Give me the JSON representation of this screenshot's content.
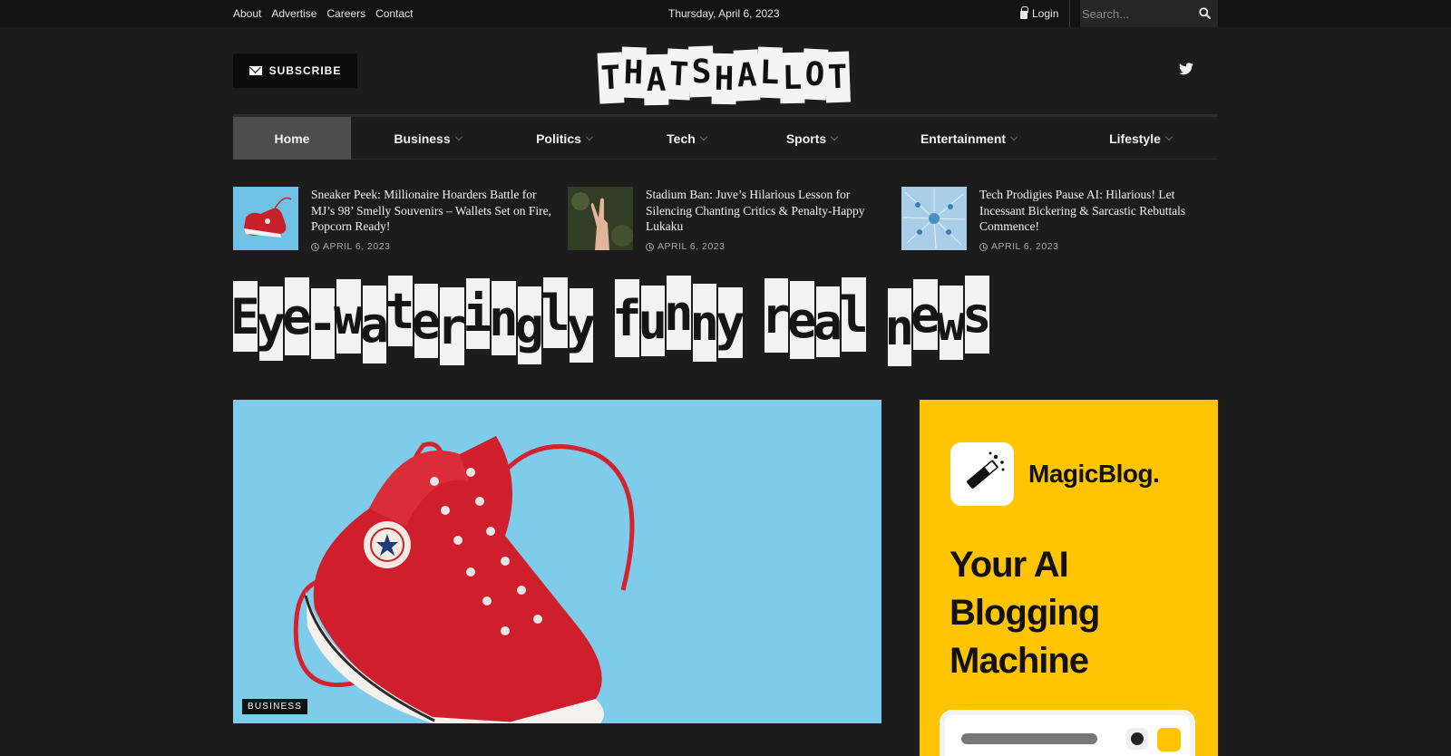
{
  "topbar": {
    "links": [
      "About",
      "Advertise",
      "Careers",
      "Contact"
    ],
    "date": "Thursday, April 6, 2023",
    "login": "Login",
    "search_placeholder": "Search..."
  },
  "header": {
    "subscribe_label": "SUBSCRIBE",
    "logo_text": "THATSHALLOT"
  },
  "nav": {
    "items": [
      {
        "label": "Home",
        "active": true
      },
      {
        "label": "Business"
      },
      {
        "label": "Politics"
      },
      {
        "label": "Tech"
      },
      {
        "label": "Sports"
      },
      {
        "label": "Entertainment"
      },
      {
        "label": "Lifestyle"
      }
    ]
  },
  "trending": [
    {
      "title": "Sneaker Peek: Millionaire Hoarders Battle for MJ’s 98’ Smelly Souvenirs – Wallets Set on Fire, Popcorn Ready!",
      "date": "APRIL 6, 2023"
    },
    {
      "title": "Stadium Ban: Juve’s Hilarious Lesson for Silencing Chanting Critics & Penalty-Happy Lukaku",
      "date": "APRIL 6, 2023"
    },
    {
      "title": "Tech Prodigies Pause AI: Hilarious! Let Incessant Bickering & Sarcastic Rebuttals Commence!",
      "date": "APRIL 6, 2023"
    }
  ],
  "tagline": "Eye-wateringly funny real news",
  "hero": {
    "category": "BUSINESS"
  },
  "ad": {
    "brand": "MagicBlog.",
    "headline": "Your AI Blogging Machine"
  }
}
